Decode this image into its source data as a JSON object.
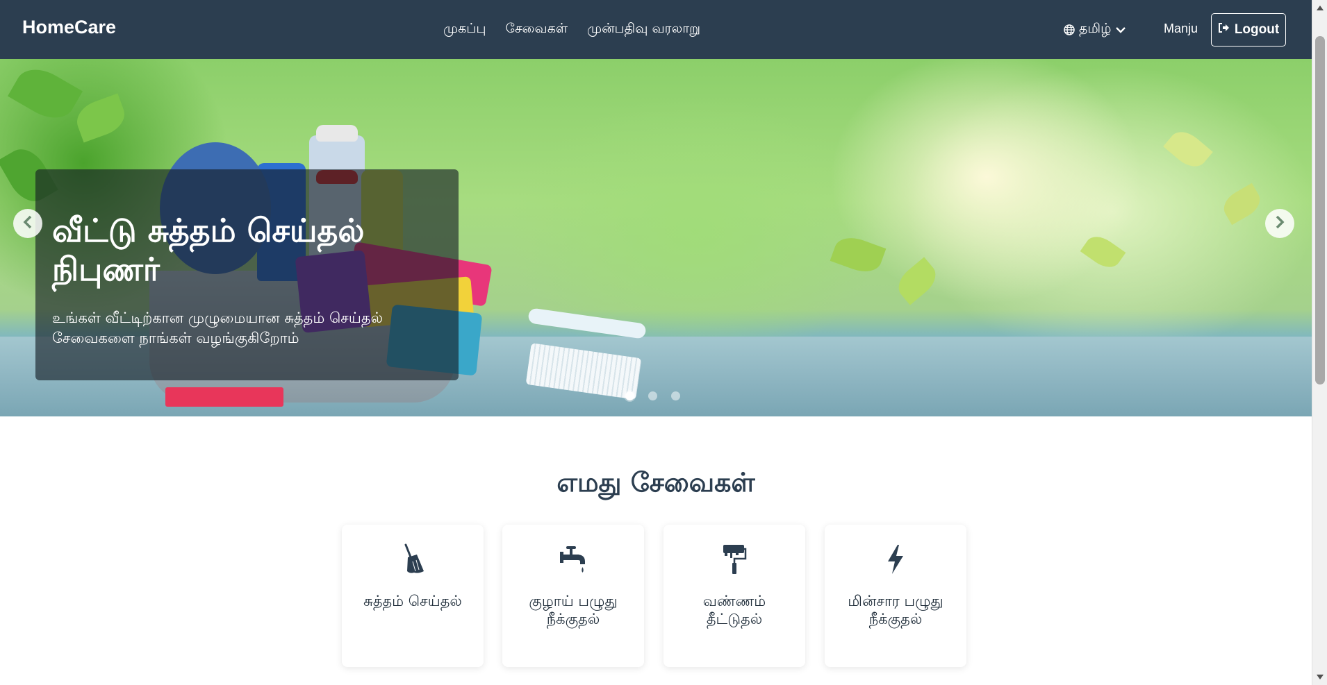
{
  "navbar": {
    "brand": "HomeCare",
    "links": [
      "முகப்பு",
      "சேவைகள்",
      "முன்பதிவு வரலாறு"
    ],
    "language": "தமிழ்",
    "user_name": "Manju",
    "logout_label": "Logout"
  },
  "hero": {
    "title": "வீட்டு சுத்தம் செய்தல் நிபுணர்",
    "subtitle": "உங்கள் வீட்டிற்கான முழுமையான சுத்தம் செய்தல் சேவைகளை நாங்கள் வழங்குகிறோம்",
    "slide_count": 3,
    "active_slide": 1
  },
  "services": {
    "heading": "எமது சேவைகள்",
    "items": [
      {
        "label": "சுத்தம் செய்தல்",
        "icon": "broom-icon"
      },
      {
        "label": "குழாய் பழுது நீக்குதல்",
        "icon": "faucet-icon"
      },
      {
        "label": "வண்ணம் தீட்டுதல்",
        "icon": "paint-roller-icon"
      },
      {
        "label": "மின்சார பழுது நீக்குதல்",
        "icon": "lightning-icon"
      }
    ]
  },
  "colors": {
    "navbar_bg": "#2c3e50",
    "text_dark": "#2c3e50"
  }
}
